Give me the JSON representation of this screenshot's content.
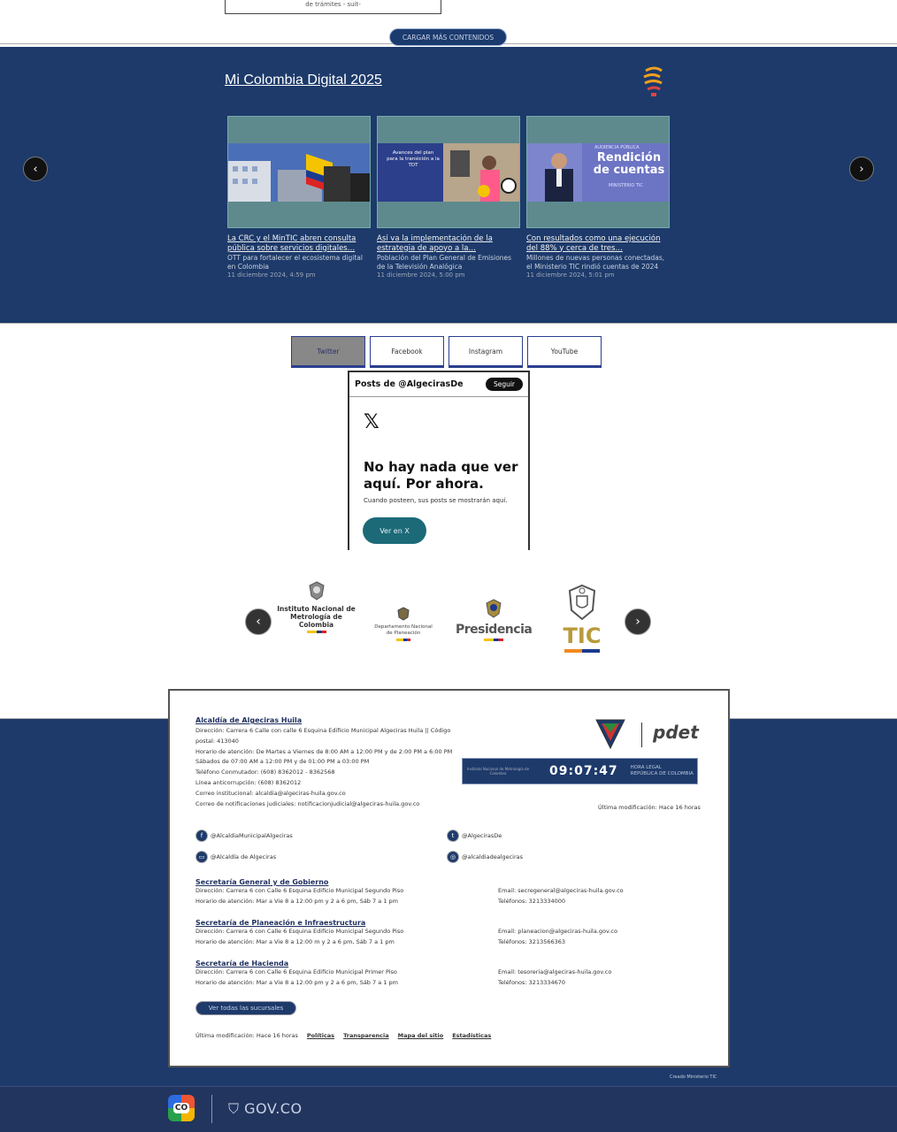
{
  "top": {
    "prev_card_text": "de trámites - suit-",
    "load_more_label": "CARGAR MÁS CONTENIDOS"
  },
  "news": {
    "title": "Mi Colombia Digital 2025",
    "prev_label": "‹",
    "next_label": "›",
    "items": [
      {
        "title": "La CRC y el MinTIC abren consulta pública sobre servicios digitales…",
        "desc": "OTT para fortalecer el ecosistema digital en Colombia",
        "date": "11 diciembre 2024, 4:59 pm"
      },
      {
        "title": "Así va la implementación de la estrategia de apoyo a la…",
        "desc": "Población del Plan General de Emisiones de la Televisión Analógica",
        "date": "11 diciembre 2024, 5:00 pm",
        "img_text": "Avances del plan para la transición a la TDT"
      },
      {
        "title": "Con resultados como una ejecución del 88% y cerca de tres…",
        "desc": "Millones de nuevas personas conectadas, el Ministerio TIC rindió cuentas de 2024",
        "date": "11 diciembre 2024, 5:01 pm",
        "img_text_1": "Rendición",
        "img_text_2": "de cuentas",
        "img_text_3": "MINISTERIO TIC",
        "img_text_top": "AUDIENCIA PÚBLICA"
      }
    ]
  },
  "social": {
    "tabs": [
      "Twitter",
      "Facebook",
      "Instagram",
      "YouTube"
    ],
    "active_tab": "Twitter",
    "feed_title": "Posts de @AlgecirasDe",
    "follow_label": "Seguir",
    "x_logo": "𝕏",
    "empty_title": "No hay nada que ver aquí. Por ahora.",
    "empty_sub": "Cuando posteen, sus posts se mostrarán aquí.",
    "view_on_x": "Ver en X"
  },
  "partners": {
    "prev_label": "‹",
    "next_label": "›",
    "inm": "Instituto Nacional de Metrología de Colombia",
    "dnp": "Departamento Nacional de Planeación",
    "presidencia": "Presidencia",
    "tic": "TIC"
  },
  "footer": {
    "entity": "Alcaldía de Algeciras Huila",
    "lines": [
      "Dirección: Carrera 6 Calle con calle 6 Esquina Edificio Municipal Algeciras Huila || Código postal: 413040",
      "Horario de atención: De Martes a Viernes de 8:00 AM a 12:00 PM y de 2:00 PM a 6:00 PM",
      "Sábados de 07:00 AM a 12:00 PM y de 01:00 PM a 03:00 PM",
      "Teléfono Conmutador: (608) 8362012 - 8362568",
      "Línea anticorrupción: (608) 8362012",
      "Correo institucional: alcaldia@algeciras-huila.gov.co",
      "Correo de notificaciones judiciales: notificacionjudicial@algeciras-huila.gov.co"
    ],
    "pdet_label": "pdet",
    "clock_inst": "Instituto Nacional de Metrología de Colombia",
    "clock_time": "09:07:47",
    "clock_legal_1": "HORA LEGAL",
    "clock_legal_2": "REPÚBLICA DE COLOMBIA",
    "last_mod_right": "Última modificación: Hace 16 horas",
    "socials": [
      {
        "icon": "f",
        "name": "facebook-icon",
        "label": "@AlcaldiaMunicipalAlgeciras"
      },
      {
        "icon": "t",
        "name": "twitter-icon",
        "label": "@AlgecirasDe"
      },
      {
        "icon": "▭",
        "name": "youtube-icon",
        "label": "@Alcaldía de Algeciras"
      },
      {
        "icon": "◎",
        "name": "instagram-icon",
        "label": "@alcaldiadealgeciras"
      }
    ],
    "offices": [
      {
        "title": "Secretaría General y de Gobierno",
        "dir": "Dirección: Carrera 6 con Calle 6 Esquina Edificio Municipal Segundo Piso",
        "hours": "Horario de atención: Mar a Vie 8 a 12:00 pm y 2 a 6 pm, Sáb 7 a 1 pm",
        "email": "Email: secregeneral@algeciras-huila.gov.co",
        "phone": "Teléfonos: 3213334000"
      },
      {
        "title": "Secretaría de Planeación e Infraestructura",
        "dir": "Dirección: Carrera 6 con Calle 6 Esquina Edificio Municipal Segundo Piso",
        "hours": "Horario de atención: Mar a Vie 8 a 12:00 m y 2 a 6 pm, Sáb 7 a 1 pm",
        "email": "Email: planeacion@algeciras-huila.gov.co",
        "phone": "Teléfonos: 3213566363"
      },
      {
        "title": "Secretaría de Hacienda",
        "dir": "Dirección: Carrera 6 con Calle 6 Esquina Edificio Municipal Primer Piso",
        "hours": "Horario de atención: Mar a Vie 8 a 12:00 pm y 2 a 6 pm, Sáb 7 a 1 pm",
        "email": "Email: tesoreria@algeciras-huila.gov.co",
        "phone": "Teléfonos: 3213334670"
      }
    ],
    "all_branches_label": "Ver todas las sucursales",
    "last_mod_bottom": "Última modificación: Hace 16 horas",
    "links": [
      "Políticas",
      "Transparencia",
      "Mapa del sitio",
      "Estadísticas"
    ],
    "created_by": "Creado Ministerio TIC"
  },
  "govbar": {
    "co_label": "CO",
    "gov_label": "GOV.CO"
  }
}
